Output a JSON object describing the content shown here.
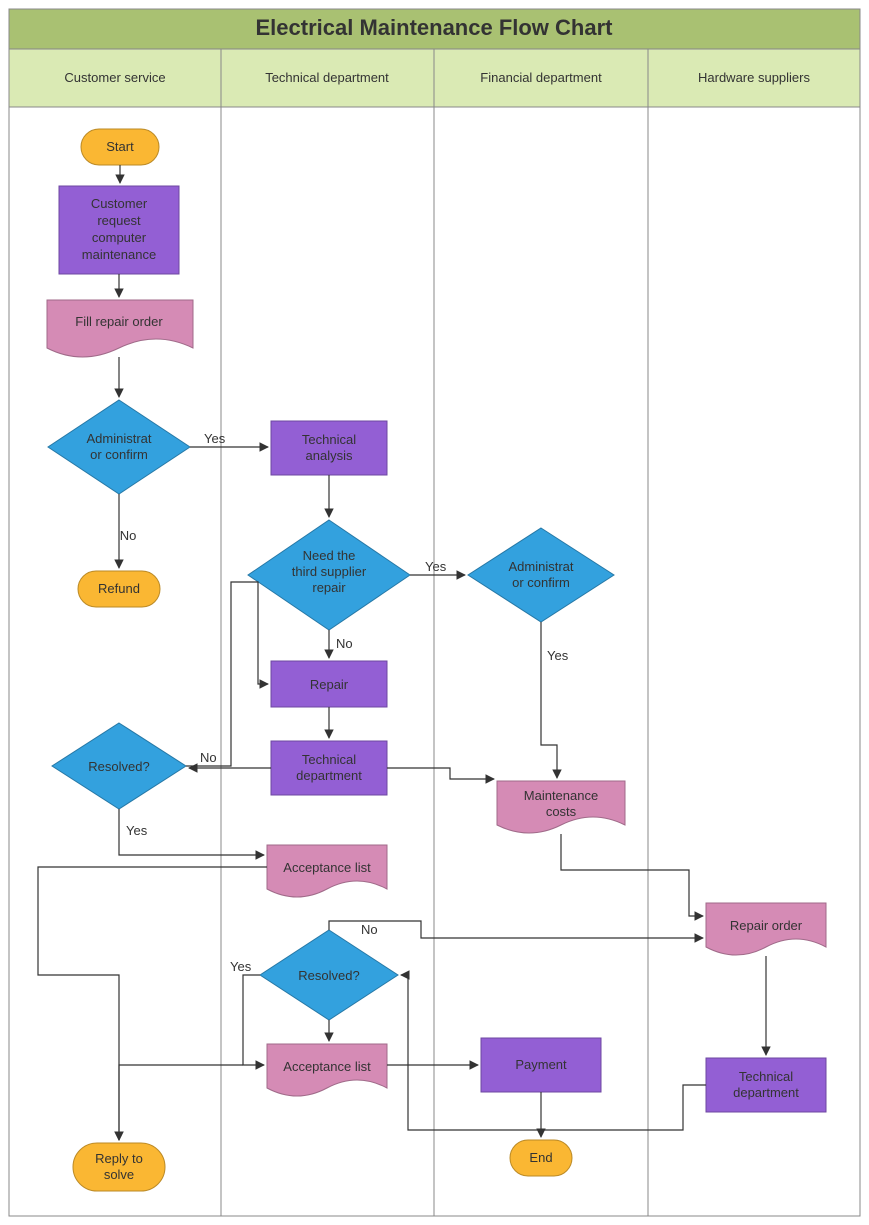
{
  "chart_data": {
    "type": "flowchart",
    "title": "Electrical Maintenance Flow Chart",
    "swimlanes": [
      "Customer service",
      "Technical department",
      "Financial department",
      "Hardware suppliers"
    ],
    "nodes": [
      {
        "id": "start",
        "lane": "Customer service",
        "type": "terminator",
        "label": "Start"
      },
      {
        "id": "request",
        "lane": "Customer service",
        "type": "process",
        "label": "Customer request computer maintenance"
      },
      {
        "id": "fill_order",
        "lane": "Customer service",
        "type": "document",
        "label": "Fill repair order"
      },
      {
        "id": "admin1",
        "lane": "Customer service",
        "type": "decision",
        "label": "Administrator confirm"
      },
      {
        "id": "refund",
        "lane": "Customer service",
        "type": "terminator",
        "label": "Refund"
      },
      {
        "id": "resolved1",
        "lane": "Customer service",
        "type": "decision",
        "label": "Resolved?"
      },
      {
        "id": "reply",
        "lane": "Customer service",
        "type": "terminator",
        "label": "Reply to solve"
      },
      {
        "id": "tech_analysis",
        "lane": "Technical department",
        "type": "process",
        "label": "Technical analysis"
      },
      {
        "id": "needsupplier",
        "lane": "Technical department",
        "type": "decision",
        "label": "Need the third supplier repair"
      },
      {
        "id": "repair",
        "lane": "Technical department",
        "type": "process",
        "label": "Repair"
      },
      {
        "id": "techdept1",
        "lane": "Technical department",
        "type": "process",
        "label": "Technical department"
      },
      {
        "id": "accept1",
        "lane": "Technical department",
        "type": "document",
        "label": "Acceptance list"
      },
      {
        "id": "resolved2",
        "lane": "Technical department",
        "type": "decision",
        "label": "Resolved?"
      },
      {
        "id": "accept2",
        "lane": "Technical department",
        "type": "document",
        "label": "Acceptance list"
      },
      {
        "id": "admin2",
        "lane": "Financial department",
        "type": "decision",
        "label": "Administrator confirm"
      },
      {
        "id": "maint_costs",
        "lane": "Financial department",
        "type": "document",
        "label": "Maintenance costs"
      },
      {
        "id": "payment",
        "lane": "Financial department",
        "type": "process",
        "label": "Payment"
      },
      {
        "id": "end",
        "lane": "Financial department",
        "type": "terminator",
        "label": "End"
      },
      {
        "id": "repair_order",
        "lane": "Hardware suppliers",
        "type": "document",
        "label": "Repair order"
      },
      {
        "id": "techdept2",
        "lane": "Hardware suppliers",
        "type": "process",
        "label": "Technical department"
      }
    ],
    "edges": [
      {
        "from": "start",
        "to": "request"
      },
      {
        "from": "request",
        "to": "fill_order"
      },
      {
        "from": "fill_order",
        "to": "admin1"
      },
      {
        "from": "admin1",
        "to": "tech_analysis",
        "label": "Yes"
      },
      {
        "from": "admin1",
        "to": "refund",
        "label": "No"
      },
      {
        "from": "tech_analysis",
        "to": "needsupplier"
      },
      {
        "from": "needsupplier",
        "to": "admin2",
        "label": "Yes"
      },
      {
        "from": "needsupplier",
        "to": "repair",
        "label": "No"
      },
      {
        "from": "admin2",
        "to": "maint_costs",
        "label": "Yes"
      },
      {
        "from": "repair",
        "to": "techdept1"
      },
      {
        "from": "techdept1",
        "to": "resolved1"
      },
      {
        "from": "techdept1",
        "to": "maint_costs"
      },
      {
        "from": "resolved1",
        "to": "repair",
        "label": "No"
      },
      {
        "from": "resolved1",
        "to": "accept1",
        "label": "Yes"
      },
      {
        "from": "accept1",
        "to": "reply"
      },
      {
        "from": "maint_costs",
        "to": "repair_order"
      },
      {
        "from": "repair_order",
        "to": "techdept2"
      },
      {
        "from": "techdept2",
        "to": "resolved2"
      },
      {
        "from": "resolved2",
        "to": "accept2",
        "label": "Yes"
      },
      {
        "from": "resolved2",
        "to": "repair_order",
        "label": "No"
      },
      {
        "from": "accept2",
        "to": "payment"
      },
      {
        "from": "payment",
        "to": "end"
      },
      {
        "from": "resolved2",
        "to": "reply",
        "label": "Yes"
      }
    ]
  },
  "labels": {
    "yes": "Yes",
    "no": "No"
  }
}
